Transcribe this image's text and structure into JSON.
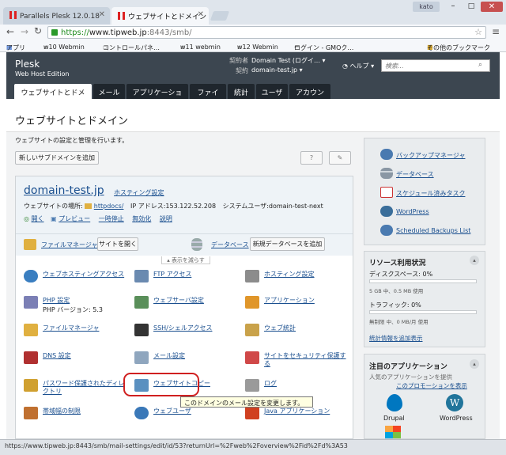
{
  "browser": {
    "tabs": [
      {
        "label": "Parallels Plesk 12.0.18"
      },
      {
        "label": "ウェブサイトとドメイン"
      }
    ],
    "window_user": "kato",
    "url_https": "https://",
    "url_host": "www.tipweb.jp",
    "url_rest": ":8443/smb/",
    "bookmarks": [
      "アプリ",
      "w10 Webmin",
      "コントロールパネ…",
      "w11 webmin",
      "w12 Webmin",
      "ログイン - GMOク…",
      "その他のブックマーク"
    ]
  },
  "plesk": {
    "logo": "Plesk",
    "edition": "Web Host Edition",
    "subscriber_label": "契約者",
    "subscriber": "Domain Test (ログイ… ▾",
    "subscription_label": "契約",
    "subscription": "domain-test.jp ▾",
    "help": "ヘルプ ▾",
    "search_placeholder": "検索...",
    "nav_tabs": [
      "ウェブサイトとドメイン",
      "メール",
      "アプリケーション",
      "ファイル",
      "統計",
      "ユーザ",
      "アカウント"
    ]
  },
  "main": {
    "page_title": "ウェブサイトとドメイン",
    "page_desc": "ウェブサイトの設定と管理を行います。",
    "add_subdomain": "新しいサブドメインを追加",
    "help_btn": "?",
    "domain": {
      "name": "domain-test.jp",
      "hosting_link": "ホスティング設定",
      "location_label": "ウェブサイトの場所:",
      "location": "httpdocs/",
      "ip": "IP アドレス:153.122.52.208",
      "sysuser": "システムユーザ:domain-test-next",
      "actions": [
        "開く",
        "プレビュー",
        "一時停止",
        "無効化",
        "説明"
      ]
    },
    "file_manager": "ファイルマネージャ",
    "open_site": "サイトを開く",
    "databases": "データベース",
    "add_db": "新規データベースを追加",
    "collapse": "表示を減らす",
    "tools": [
      {
        "label": "ウェブホスティングアクセス",
        "icon": "globe-icon"
      },
      {
        "label": "FTP アクセス",
        "icon": "ftp-icon"
      },
      {
        "label": "ホスティング設定",
        "icon": "hosting-settings-icon"
      },
      {
        "label": "PHP 設定",
        "sub": "PHP バージョン: 5.3",
        "icon": "php-icon"
      },
      {
        "label": "ウェブサーバ設定",
        "icon": "webserver-icon"
      },
      {
        "label": "アプリケーション",
        "icon": "gear-icon"
      },
      {
        "label": "ファイルマネージャ",
        "icon": "folder-icon"
      },
      {
        "label": "SSH/シェルアクセス",
        "icon": "terminal-icon"
      },
      {
        "label": "ウェブ統計",
        "icon": "stats-icon"
      },
      {
        "label": "DNS 設定",
        "icon": "dns-icon"
      },
      {
        "label": "メール設定",
        "icon": "mail-icon"
      },
      {
        "label": "サイトをセキュリティ保護する",
        "icon": "certificate-icon"
      },
      {
        "label": "パスワード保護されたディレクトリ",
        "icon": "locked-folder-icon"
      },
      {
        "label": "ウェブサイトコピー",
        "icon": "site-copy-icon"
      },
      {
        "label": "ログ",
        "icon": "log-icon"
      },
      {
        "label": "帯域幅の制限",
        "icon": "bandwidth-icon"
      },
      {
        "label": "ウェブユーザ",
        "icon": "web-users-icon"
      },
      {
        "label": "Java アプリケーション",
        "icon": "java-icon"
      }
    ],
    "tooltip": "このドメインのメール設定を変更します。"
  },
  "sidebar": {
    "links": [
      "バックアップマネージャ",
      "データベース",
      "スケジュール済みタスク",
      "WordPress",
      "Scheduled Backups List"
    ],
    "resources_title": "リソース利用状況",
    "disk_label": "ディスクスペース: 0%",
    "disk_detail": "5 GB 中、0.5 MB 使用",
    "traffic_label": "トラフィック: 0%",
    "traffic_detail": "無制限 中、0 MB/月 使用",
    "stats_link": "統計情報を追加表示",
    "apps_title": "注目のアプリケーション",
    "apps_desc": "人気のアプリケーションを提供",
    "apps_desc2": "このプロモーションを表示",
    "apps": [
      "Drupal",
      "WordPress",
      "Joomla"
    ]
  },
  "status_url": "https://www.tipweb.jp:8443/smb/mail-settings/edit/id/53?returnUrl=%2Fweb%2Foverview%2Fid%2Fd%3A53"
}
